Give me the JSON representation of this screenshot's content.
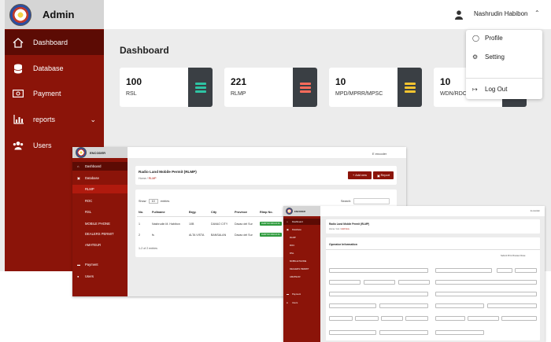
{
  "admin": {
    "brand_title": "Admin",
    "nav": [
      {
        "label": "Dashboard",
        "icon": "home-icon"
      },
      {
        "label": "Database",
        "icon": "database-icon"
      },
      {
        "label": "Payment",
        "icon": "money-icon"
      },
      {
        "label": "reports",
        "icon": "chart-icon"
      },
      {
        "label": "Users",
        "icon": "users-icon"
      }
    ],
    "user_name": "Nashrudin Habibon",
    "page_title": "Dashboard",
    "cards": [
      {
        "value": "100",
        "label": "RSL",
        "color": "#2ec4a4"
      },
      {
        "value": "221",
        "label": "RLMP",
        "color": "#ff6b5b"
      },
      {
        "value": "10",
        "label": "MPD/MPRR/MPSC",
        "color": "#f4c430"
      },
      {
        "value": "10",
        "label": "WDN/RDC",
        "color": "#8b9aa8"
      }
    ],
    "dropdown": {
      "profile": "Profile",
      "setting": "Setting",
      "logout": "Log Out"
    }
  },
  "encoder_list": {
    "brand_title": "ENCODER",
    "user": "E encoder",
    "nav": {
      "dashboard": "Dashboard",
      "database": "Database",
      "rlmp": "RLMP",
      "roc": "ROC",
      "rsl": "RSL",
      "mobile_phone": "MOBILE PHONE",
      "dealers_permit": "DEALERS PERMIT",
      "amateur": "AMATEUR",
      "payment": "Payment",
      "users": "Users"
    },
    "title": "Radio Land Mobile Permit (RLMP)",
    "crumb_home": "Home",
    "crumb_current": "RLMP",
    "btn_add": "Add new",
    "btn_report": "Report",
    "show_label": "Show",
    "show_value": "10",
    "entries_label": "entries",
    "search_label": "Search:",
    "columns": [
      "No.",
      "Fullname",
      "Brgy.",
      "City",
      "Province",
      "Rlmp No."
    ],
    "rows": [
      {
        "no": "1",
        "fullname": "Nashrudin M. Habibon",
        "brgy": "10B",
        "city": "DAVAO CITY",
        "province": "Davao del Sur",
        "tag": "RLMP NO 0001-00 01"
      },
      {
        "no": "2",
        "fullname": "fs",
        "brgy": "ALTA VISTA",
        "city": "BANSALAN",
        "province": "Davao del Sur",
        "tag": "RLMP NO 0002-00 01"
      }
    ],
    "footer": "1-2 of 2 entries"
  },
  "encoder_form": {
    "brand_title": "ENCODER",
    "user": "E encoder",
    "nav": {
      "dashboard": "Dashboard",
      "database": "Database",
      "rlmp": "RLMP",
      "roc": "ROC",
      "rsl": "RSL",
      "mobile_phone": "MOBILE PHONE",
      "dealers_permit": "DEALERS PERMIT",
      "amateur": "AMATEUR",
      "payment": "Payment",
      "users": "Users"
    },
    "title": "Radio Land Mobile Permit (RLMP)",
    "crumb_home": "Home",
    "crumb_list": "List",
    "crumb_current": "Add New",
    "section": "Operator Information",
    "actions": "Submit   Print Preview   Close"
  }
}
